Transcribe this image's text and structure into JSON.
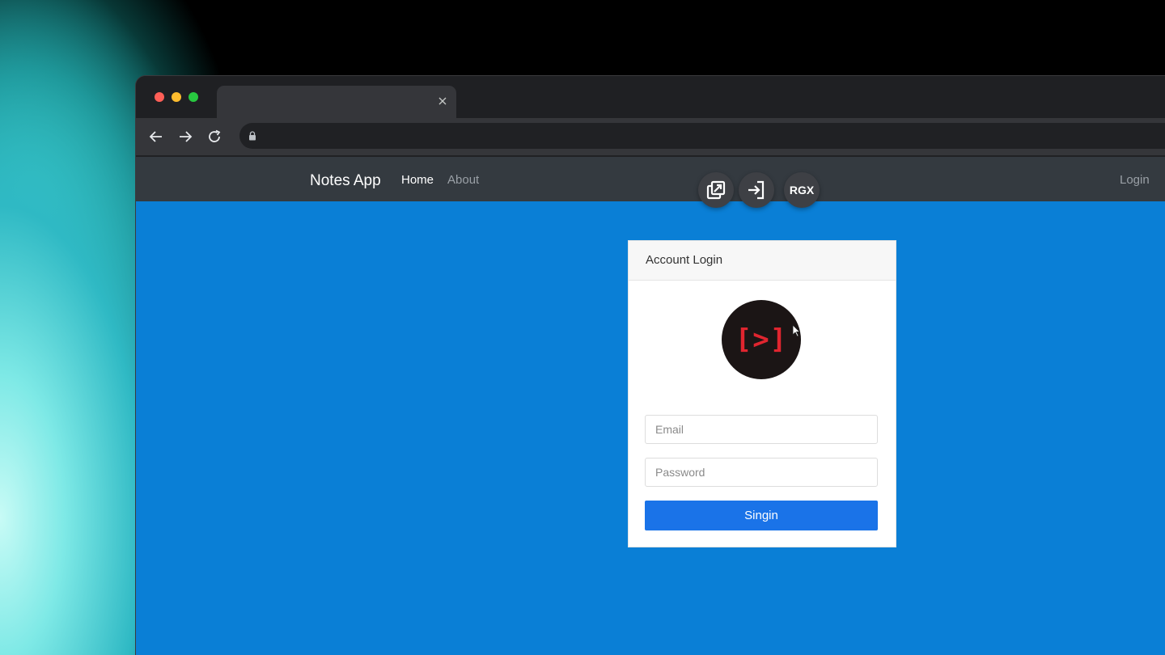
{
  "browser": {
    "tab": {
      "title": ""
    },
    "address": {
      "url": ""
    }
  },
  "app": {
    "brand": "Notes App",
    "nav": {
      "home": "Home",
      "about": "About",
      "login": "Login"
    },
    "extensions": {
      "rgx_label": "RGX"
    }
  },
  "login_card": {
    "header": "Account Login",
    "logo_text": "[>]",
    "email_placeholder": "Email",
    "password_placeholder": "Password",
    "submit_label": "Singin"
  },
  "colors": {
    "page_background": "#0a7fd6",
    "navbar": "#343a40",
    "button": "#1a73e8",
    "logo_accent": "#e0252f"
  }
}
